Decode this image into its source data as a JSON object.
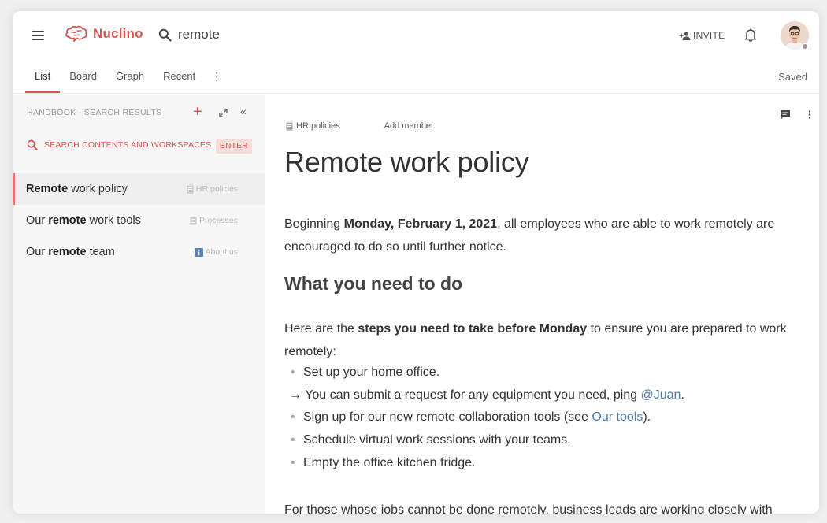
{
  "app": {
    "name": "Nuclino",
    "brand_color": "#d9534f"
  },
  "header": {
    "search_query": "remote",
    "invite_label": "INVITE"
  },
  "tabs": [
    {
      "label": "List",
      "active": true
    },
    {
      "label": "Board",
      "active": false
    },
    {
      "label": "Graph",
      "active": false
    },
    {
      "label": "Recent",
      "active": false
    }
  ],
  "tab_more": "⋮",
  "status": "Saved",
  "sidebar": {
    "header": "HANDBOOK - SEARCH RESULTS",
    "search_label": "SEARCH CONTENTS AND WORKSPACES",
    "enter_label": "ENTER",
    "items": [
      {
        "pre": "",
        "bold": "Remote",
        "post": " work policy",
        "location": "HR policies",
        "icon": "document-icon",
        "selected": true
      },
      {
        "pre": "Our ",
        "bold": "remote",
        "post": " work tools",
        "location": "Processes",
        "icon": "document-icon",
        "selected": false
      },
      {
        "pre": "Our ",
        "bold": "remote",
        "post": " team",
        "location": "About us",
        "icon": "info-icon",
        "selected": false
      }
    ]
  },
  "document": {
    "breadcrumb": "HR policies",
    "add_member": "Add member",
    "title": "Remote work policy",
    "p1": {
      "a": "Beginning ",
      "b": "Monday, February 1, 2021",
      "c": ", all  employees who are able to work remotely are encouraged to do so until further notice."
    },
    "h2": "What you need to do",
    "p2": {
      "a": "Here are the ",
      "b": "steps you need to take before Monday",
      "c": " to ensure you are prepared to work remotely:"
    },
    "bullets": {
      "b1": "Set up your home office.",
      "b1_sub_pre": "→  You can submit a request for any equipment you need, ping ",
      "b1_sub_link": "@Juan",
      "b1_sub_post": ".",
      "b2_pre": "Sign up for our new remote collaboration tools (see ",
      "b2_link": "Our tools",
      "b2_post": ").",
      "b3": "Schedule virtual work sessions with your teams.",
      "b4": "Empty the office kitchen fridge."
    },
    "p3": "For those whose jobs cannot be done remotely, business leads are working closely with"
  }
}
